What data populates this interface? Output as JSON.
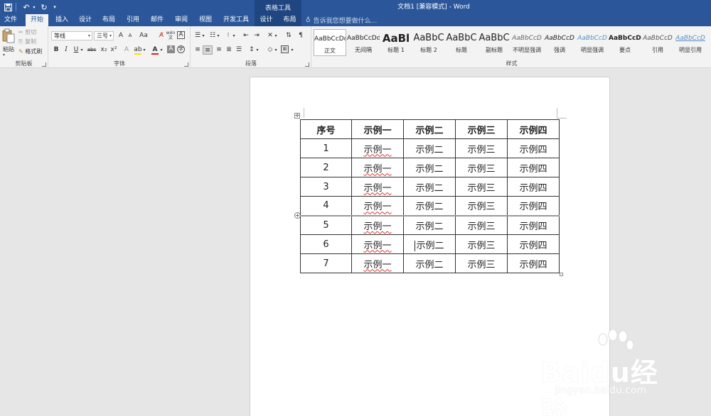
{
  "window": {
    "title": "文档1 [兼容模式] - Word",
    "contextual_group": "表格工具",
    "tell_me_placeholder": "告诉我您想要做什么..."
  },
  "tabs": [
    {
      "label": "文件",
      "active": false
    },
    {
      "label": "开始",
      "active": true
    },
    {
      "label": "插入",
      "active": false
    },
    {
      "label": "设计",
      "active": false
    },
    {
      "label": "布局",
      "active": false
    },
    {
      "label": "引用",
      "active": false
    },
    {
      "label": "邮件",
      "active": false
    },
    {
      "label": "审阅",
      "active": false
    },
    {
      "label": "视图",
      "active": false
    },
    {
      "label": "开发工具",
      "active": false
    },
    {
      "label": "设计",
      "active": false
    },
    {
      "label": "布局",
      "active": false
    }
  ],
  "ribbon": {
    "clipboard": {
      "paste": "粘贴",
      "cut": "剪切",
      "copy": "复制",
      "format_painter": "格式刷",
      "group_label": "剪贴板"
    },
    "font": {
      "font_name": "等线",
      "font_size": "三号",
      "grow": "A",
      "shrink": "A",
      "change_case": "Aa",
      "bold": "B",
      "italic": "I",
      "underline": "U",
      "strikethrough": "abc",
      "subscript": "x₂",
      "superscript": "x²",
      "group_label": "字体"
    },
    "paragraph": {
      "group_label": "段落"
    },
    "styles": {
      "group_label": "样式",
      "items": [
        {
          "sample": "AaBbCcDd",
          "name": "正文",
          "selected": true
        },
        {
          "sample": "AaBbCcDd",
          "name": "无间隔",
          "selected": false
        },
        {
          "sample": "AaBl",
          "name": "标题 1",
          "selected": false
        },
        {
          "sample": "AaBbC",
          "name": "标题 2",
          "selected": false
        },
        {
          "sample": "AaBbC",
          "name": "标题",
          "selected": false
        },
        {
          "sample": "AaBbC",
          "name": "副标题",
          "selected": false
        },
        {
          "sample": "AaBbCcD",
          "name": "不明显强调",
          "selected": false
        },
        {
          "sample": "AaBbCcD",
          "name": "强调",
          "selected": false
        },
        {
          "sample": "AaBbCcD",
          "name": "明显强调",
          "selected": false
        },
        {
          "sample": "AaBbCcDd",
          "name": "要点",
          "selected": false
        },
        {
          "sample": "AaBbCcD",
          "name": "引用",
          "selected": false
        },
        {
          "sample": "AaBbCcD",
          "name": "明显引用",
          "selected": false
        }
      ]
    }
  },
  "table": {
    "header": [
      "序号",
      "示例一",
      "示例二",
      "示例三",
      "示例四"
    ],
    "rows": [
      [
        "1",
        "示例一",
        "示例二",
        "示例三",
        "示例四"
      ],
      [
        "2",
        "示例一",
        "示例二",
        "示例三",
        "示例四"
      ],
      [
        "3",
        "示例一",
        "示例二",
        "示例三",
        "示例四"
      ],
      [
        "4",
        "示例一",
        "示例二",
        "示例三",
        "示例四"
      ],
      [
        "5",
        "示例一",
        "示例二",
        "示例三",
        "示例四"
      ],
      [
        "6",
        "示例一",
        "示例二",
        "示例三",
        "示例四"
      ],
      [
        "7",
        "示例一",
        "示例二",
        "示例三",
        "示例四"
      ]
    ]
  },
  "watermark": {
    "brand": "Baidu经验",
    "url": "jingyan.baidu.com"
  },
  "colors": {
    "titlebar": "#2b579a",
    "contextual": "#1f4680",
    "ribbon": "#f3f3f3",
    "canvas": "#e6e6e6"
  }
}
